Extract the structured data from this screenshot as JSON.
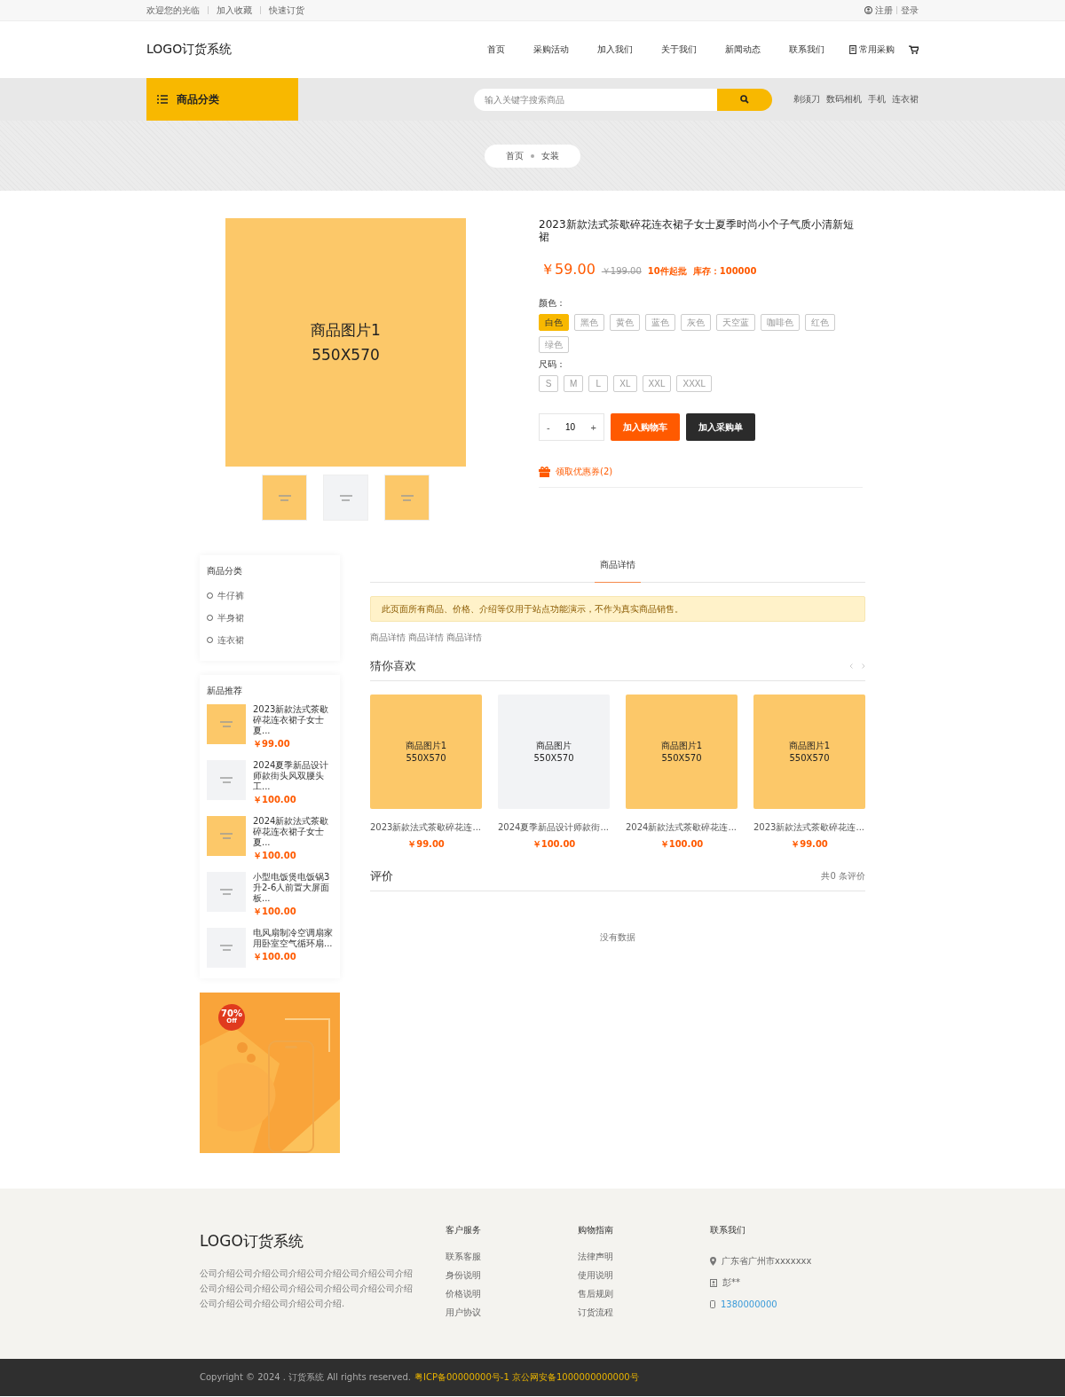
{
  "top_bar": {
    "links": [
      "欢迎您的光临",
      "加入收藏",
      "快速订货"
    ],
    "auth": [
      "注册",
      "登录"
    ]
  },
  "header": {
    "logo": "LOGO订货系统",
    "nav": [
      "首页",
      "采购活动",
      "加入我们",
      "关于我们",
      "新闻动态",
      "联系我们"
    ],
    "purchase": "常用采购"
  },
  "category_bar": {
    "title": "商品分类",
    "search": {
      "placeholder": "输入关键字搜索商品"
    },
    "hot": [
      "剃须刀",
      "数码相机",
      "手机",
      "连衣裙"
    ]
  },
  "breadcrumb": [
    "首页",
    "女装"
  ],
  "product": {
    "image": [
      "商品图片1",
      "550X570"
    ],
    "thumbs": [
      {
        "color": "#fcc869"
      },
      {
        "color": "#f2f3f5"
      },
      {
        "color": "#fcc869"
      }
    ],
    "title": "2023新款法式茶歇碎花连衣裙子女士夏季时尚小个子气质小清新短裙",
    "price": "￥59.00",
    "original_price": "￥199.00",
    "min_order": "10件起批",
    "stock": "库存：100000",
    "options": [
      {
        "label": "颜色：",
        "values": [
          {
            "label": "白色",
            "selected": true
          },
          {
            "label": "黑色",
            "selected": false
          },
          {
            "label": "黄色",
            "selected": false
          },
          {
            "label": "蓝色",
            "selected": false
          },
          {
            "label": "灰色",
            "selected": false
          },
          {
            "label": "天空蓝",
            "selected": false
          },
          {
            "label": "咖啡色",
            "selected": false
          },
          {
            "label": "红色",
            "selected": false
          },
          {
            "label": "绿色",
            "selected": false
          }
        ]
      },
      {
        "label": "尺码：",
        "values": [
          {
            "label": "S",
            "selected": false
          },
          {
            "label": "M",
            "selected": false
          },
          {
            "label": "L",
            "selected": false
          },
          {
            "label": "XL",
            "selected": false
          },
          {
            "label": "XXL",
            "selected": false
          },
          {
            "label": "XXXL",
            "selected": false
          }
        ]
      }
    ],
    "quantity": {
      "minus": "-",
      "value": "10",
      "plus": "+"
    },
    "buttons": [
      {
        "label": "加入购物车",
        "kind": "primary"
      },
      {
        "label": "加入采购单",
        "kind": "dark"
      }
    ],
    "coupon": "领取优惠券(2)"
  },
  "sidebar": {
    "categories": {
      "title": "商品分类",
      "items": [
        "牛仔裤",
        "半身裙",
        "连衣裙"
      ]
    },
    "new_products": {
      "title": "新品推荐",
      "items": [
        {
          "color": "#fcc869",
          "name": "2023新款法式茶歇碎花连衣裙子女士夏...",
          "price": "￥99.00"
        },
        {
          "color": "#f2f3f5",
          "name": "2024夏季新品设计师款街头风双腰头工...",
          "price": "￥100.00"
        },
        {
          "color": "#fcc869",
          "name": "2024新款法式茶歇碎花连衣裙子女士夏...",
          "price": "￥100.00"
        },
        {
          "color": "#f2f3f5",
          "name": "小型电饭煲电饭锅3升2-6人前置大屏面板...",
          "price": "￥100.00"
        },
        {
          "color": "#f2f3f5",
          "name": "电风扇制冷空调扇家用卧室空气循环扇...",
          "price": "￥100.00"
        }
      ]
    },
    "banner": {
      "kind": "picture",
      "badge": "70%",
      "badge_sub": "Off"
    }
  },
  "tabs": [
    {
      "label": "商品详情",
      "selected": true
    }
  ],
  "notice": "此页面所有商品、价格、介绍等仅用于站点功能演示，不作为真实商品销售。",
  "detail_text": "商品详情 商品详情 商品详情",
  "recommend": {
    "title": "猜你喜欢",
    "items": [
      {
        "color": "#fcc869",
        "image": [
          "商品图片1",
          "550X570"
        ],
        "name": "2023新款法式茶歇碎花连...",
        "price": "￥99.00"
      },
      {
        "color": "#f2f3f5",
        "image": [
          "商品图片",
          "550X570"
        ],
        "name": "2024夏季新品设计师款街...",
        "price": "￥100.00"
      },
      {
        "color": "#fcc869",
        "image": [
          "商品图片1",
          "550X570"
        ],
        "name": "2024新款法式茶歇碎花连...",
        "price": "￥100.00"
      },
      {
        "color": "#fcc869",
        "image": [
          "商品图片1",
          "550X570"
        ],
        "name": "2023新款法式茶歇碎花连...",
        "price": "￥99.00"
      }
    ]
  },
  "reviews": {
    "title": "评价",
    "count": "共0 条评价",
    "empty": "没有数据"
  },
  "footer": {
    "logo": "LOGO订货系统",
    "intro": "公司介绍公司介绍公司介绍公司介绍公司介绍公司介绍公司介绍公司介绍公司介绍公司介绍公司介绍公司介绍公司介绍公司介绍公司介绍公司介绍.",
    "columns": [
      {
        "title": "客户服务",
        "links": [
          "联系客服",
          "身份说明",
          "价格说明",
          "用户协议"
        ]
      },
      {
        "title": "购物指南",
        "links": [
          "法律声明",
          "使用说明",
          "售后规则",
          "订货流程"
        ]
      }
    ],
    "contact": {
      "title": "联系我们",
      "items": [
        {
          "kind": "address",
          "text": "广东省广州市xxxxxxx"
        },
        {
          "kind": "person",
          "text": "彭**"
        },
        {
          "kind": "phone",
          "text": "1380000000"
        }
      ]
    }
  },
  "copyright": {
    "text": "Copyright © 2024 . 订货系统 All rights reserved.",
    "icp": "粤ICP备00000000号-1 京公网安备1000000000000号"
  }
}
